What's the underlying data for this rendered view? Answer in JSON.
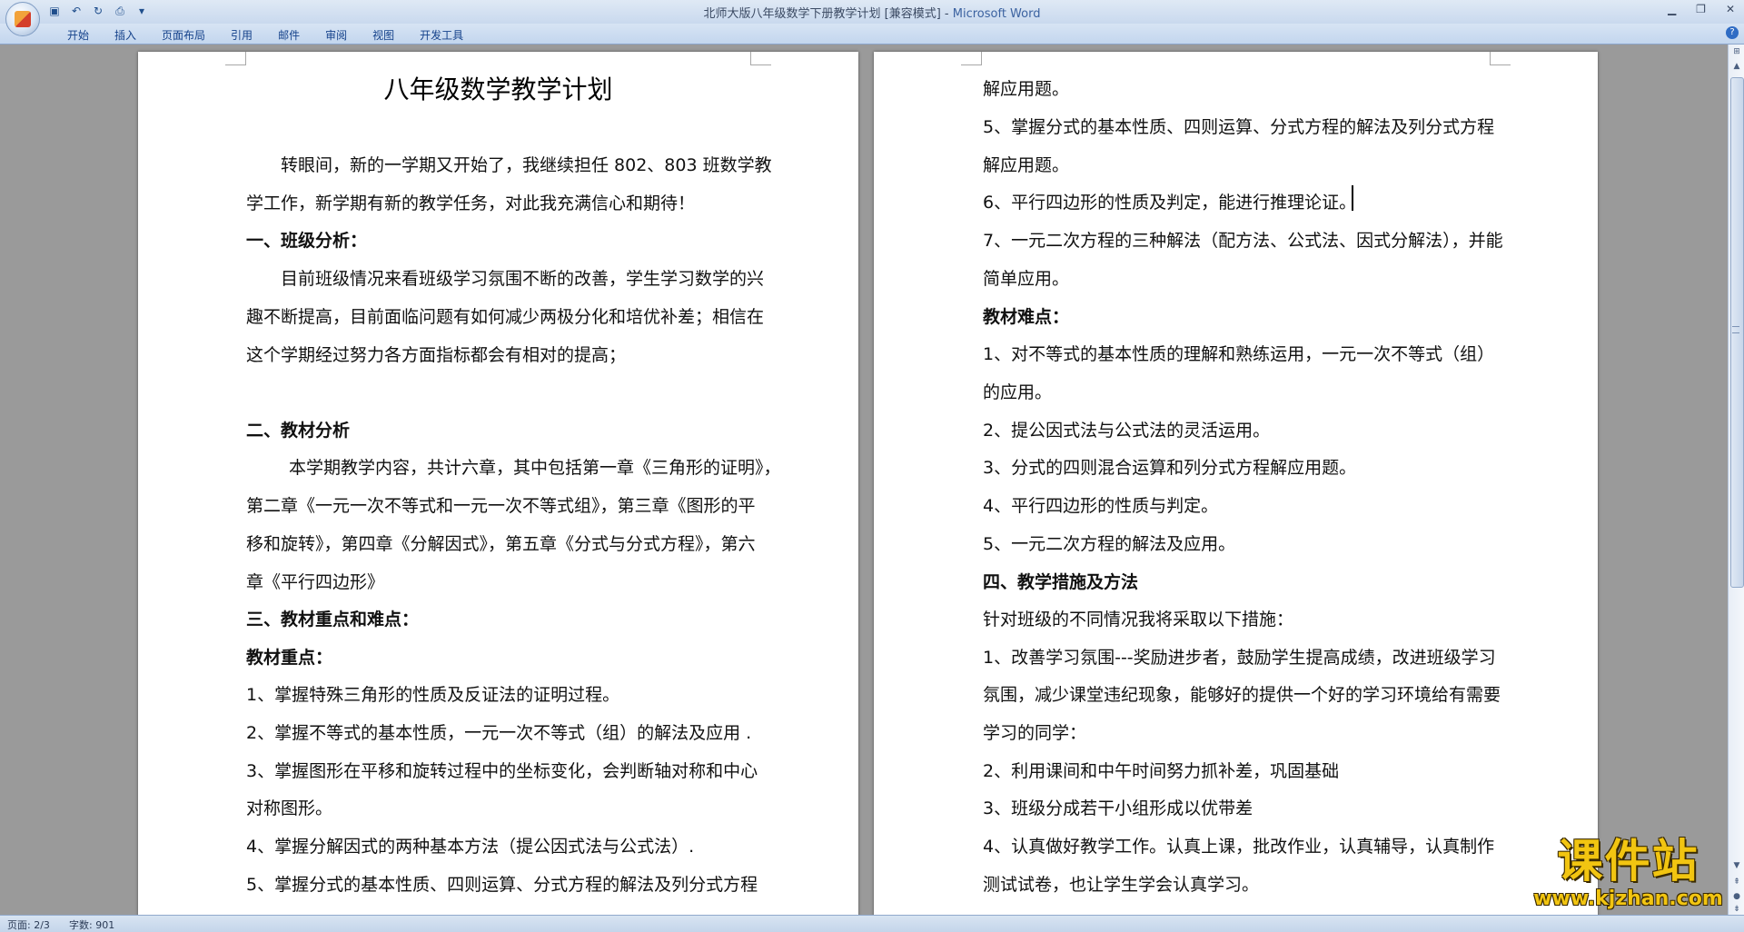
{
  "window": {
    "title": "北师大版八年级数学下册教学计划 [兼容模式]",
    "separator": " - ",
    "app_name": "Microsoft Word"
  },
  "quick_access": [
    "save-icon",
    "undo-icon",
    "redo-icon",
    "print-preview-icon",
    "customize-icon"
  ],
  "ribbon": {
    "tabs": [
      "开始",
      "插入",
      "页面布局",
      "引用",
      "邮件",
      "审阅",
      "视图",
      "开发工具"
    ]
  },
  "left_page": {
    "title": "八年级数学教学计划",
    "lines": [
      "转眼间，新的一学期又开始了，我继续担任 802、803 班数学教",
      "学工作，新学期有新的教学任务，对此我充满信心和期待！",
      "一、班级分析：",
      "目前班级情况来看班级学习氛围不断的改善，学生学习数学的兴",
      "趣不断提高，目前面临问题有如何减少两极分化和培优补差；相信在",
      "这个学期经过努力各方面指标都会有相对的提高；",
      "二、教材分析",
      "本学期教学内容，共计六章，其中包括第一章《三角形的证明》，",
      "第二章《一元一次不等式和一元一次不等式组》，第三章《图形的平",
      "移和旋转》，第四章《分解因式》，第五章《分式与分式方程》，第六",
      "章《平行四边形》",
      "三、教材重点和难点：",
      "教材重点：",
      "1、掌握特殊三角形的性质及反证法的证明过程。",
      "2、掌握不等式的基本性质，一元一次不等式（组）的解法及应用 .",
      "3、掌握图形在平移和旋转过程中的坐标变化，会判断轴对称和中心",
      "对称图形。",
      "4、掌握分解因式的两种基本方法（提公因式法与公式法）.",
      "5、掌握分式的基本性质、四则运算、分式方程的解法及列分式方程"
    ]
  },
  "right_page": {
    "lines": [
      "解应用题。",
      "5、掌握分式的基本性质、四则运算、分式方程的解法及列分式方程",
      "解应用题。",
      "6、平行四边形的性质及判定，能进行推理论证。",
      "7、一元二次方程的三种解法（配方法、公式法、因式分解法），并能",
      "简单应用。",
      "教材难点：",
      "1、对不等式的基本性质的理解和熟练运用，一元一次不等式（组）",
      "的应用。",
      "2、提公因式法与公式法的灵活运用。",
      "3、分式的四则混合运算和列分式方程解应用题。",
      "4、平行四边形的性质与判定。",
      "5、一元二次方程的解法及应用。",
      "四、教学措施及方法",
      "针对班级的不同情况我将采取以下措施：",
      "1、改善学习氛围---奖励进步者，鼓励学生提高成绩，改进班级学习",
      "氛围，减少课堂违纪现象，能够好的提供一个好的学习环境给有需要",
      "学习的同学：",
      "2、利用课间和中午时间努力抓补差，巩固基础",
      "3、班级分成若干小组形成以优带差",
      "4、认真做好教学工作。认真上课，批改作业，认真辅导，认真制作",
      "测试试卷，也让学生学会认真学习。"
    ]
  },
  "status_bar": {
    "page": "页面: 2/3",
    "words": "字数: 901"
  },
  "watermark": {
    "title": "课件站",
    "url": "www.kjzhan.com"
  }
}
